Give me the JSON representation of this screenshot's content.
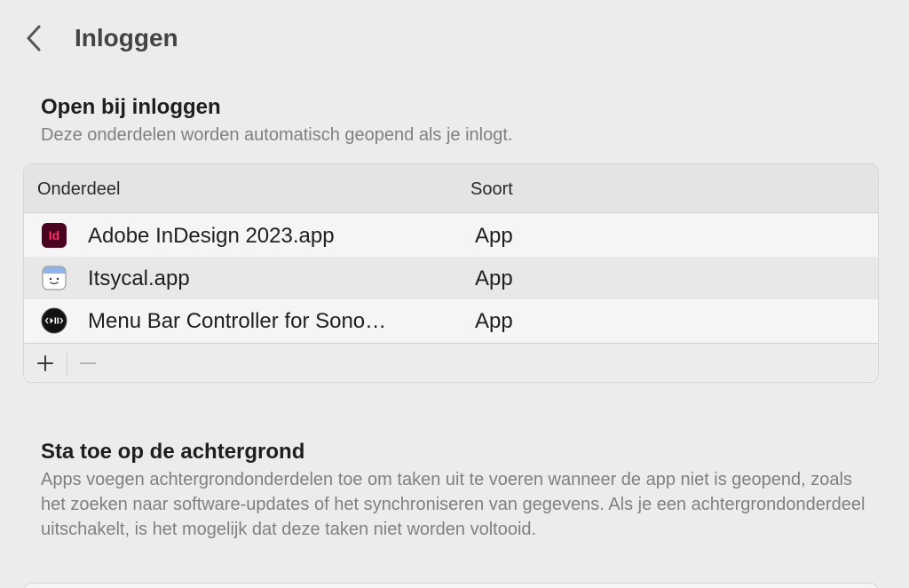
{
  "header": {
    "title": "Inloggen"
  },
  "login_items": {
    "title": "Open bij inloggen",
    "subtitle": "Deze onderdelen worden automatisch geopend als je inlogt.",
    "columns": {
      "item": "Onderdeel",
      "kind": "Soort"
    },
    "rows": [
      {
        "name": "Adobe InDesign 2023.app",
        "kind": "App",
        "icon": "indesign-icon",
        "icon_color": "#49021f",
        "icon_accent": "#ff3366"
      },
      {
        "name": "Itsycal.app",
        "kind": "App",
        "icon": "itsycal-icon"
      },
      {
        "name": "Menu Bar Controller for Sono…",
        "kind": "App",
        "icon": "sonos-controller-icon"
      }
    ],
    "icon_text": "Id"
  },
  "background": {
    "title": "Sta toe op de achtergrond",
    "description": "Apps voegen achtergrondonderdelen toe om taken uit te voeren wanneer de app niet is geopend, zoals het zoeken naar software-updates of het synchroniseren van gegevens. Als je een achtergrondonderdeel uitschakelt, is het mogelijk dat deze taken niet worden voltooid."
  }
}
